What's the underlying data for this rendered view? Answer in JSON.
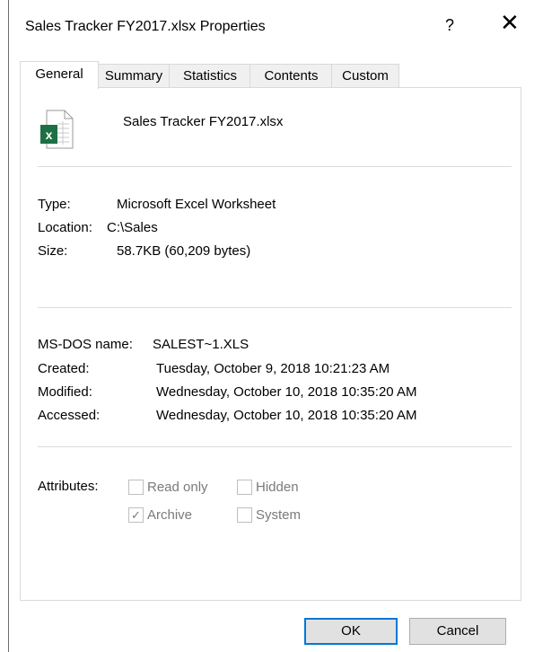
{
  "window": {
    "title": "Sales Tracker FY2017.xlsx Properties",
    "help": "?",
    "close": "✕"
  },
  "tabs": [
    "General",
    "Summary",
    "Statistics",
    "Contents",
    "Custom"
  ],
  "file": {
    "name": "Sales Tracker FY2017.xlsx",
    "icon": "excel-file-icon"
  },
  "info": {
    "type_label": "Type:",
    "type_value": "Microsoft Excel Worksheet",
    "location_label": "Location:",
    "location_value": "C:\\Sales",
    "size_label": "Size:",
    "size_value": "58.7KB (60,209 bytes)"
  },
  "dates": {
    "msdos_label": "MS-DOS name:",
    "msdos_value": "SALEST~1.XLS",
    "created_label": "Created:",
    "created_value": "Tuesday, October 9, 2018 10:21:23 AM",
    "modified_label": "Modified:",
    "modified_value": "Wednesday, October 10, 2018 10:35:20 AM",
    "accessed_label": "Accessed:",
    "accessed_value": "Wednesday, October 10, 2018 10:35:20 AM"
  },
  "attributes": {
    "label": "Attributes:",
    "read_only": "Read only",
    "hidden": "Hidden",
    "archive": "Archive",
    "system": "System",
    "archive_checked": true
  },
  "buttons": {
    "ok": "OK",
    "cancel": "Cancel"
  },
  "colors": {
    "excel_green": "#1d7044",
    "focus_blue": "#0078d7"
  }
}
